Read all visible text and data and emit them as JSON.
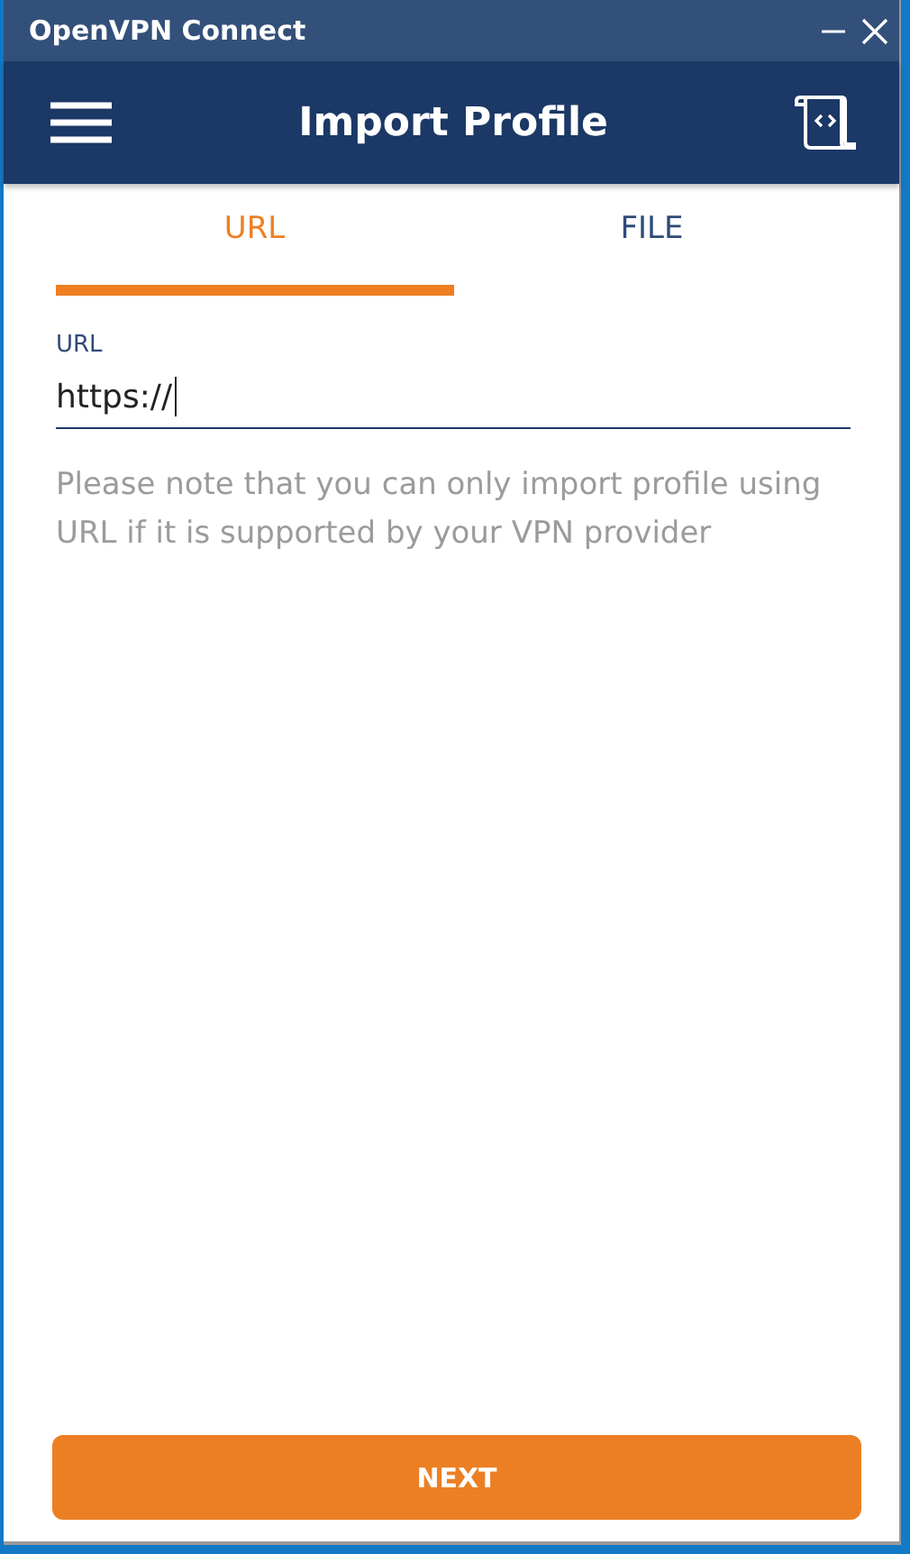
{
  "window": {
    "title": "OpenVPN Connect"
  },
  "header": {
    "title": "Import Profile"
  },
  "tabs": [
    {
      "label": "URL",
      "selected": true
    },
    {
      "label": "FILE",
      "selected": false
    }
  ],
  "url_field": {
    "label": "URL",
    "value": "https://",
    "focused": true
  },
  "note": "Please note that you can only import profile using URL if it is supported by your VPN provider",
  "buttons": [
    "NEXT"
  ]
}
